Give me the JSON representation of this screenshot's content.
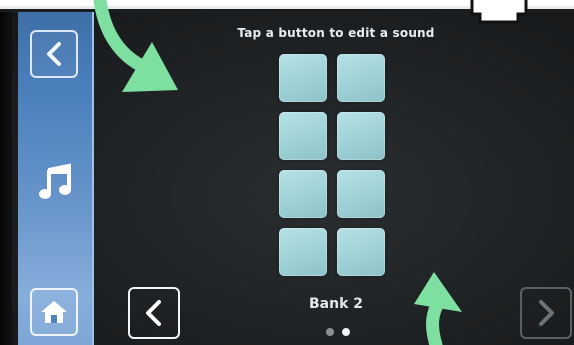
{
  "header": {
    "instruction": "Tap a button to edit a sound"
  },
  "sidebar": {
    "back_icon": "chevron-left-icon",
    "music_icon": "music-note-icon",
    "home_icon": "home-icon"
  },
  "pads": {
    "count": 8,
    "color": "#a8d8dc"
  },
  "bank": {
    "label": "Bank 2",
    "current_page": 2,
    "total_pages": 2,
    "prev_icon": "chevron-left-icon",
    "next_icon": "chevron-right-icon"
  },
  "annotations": {
    "arrow_color": "#7ee0a0"
  }
}
